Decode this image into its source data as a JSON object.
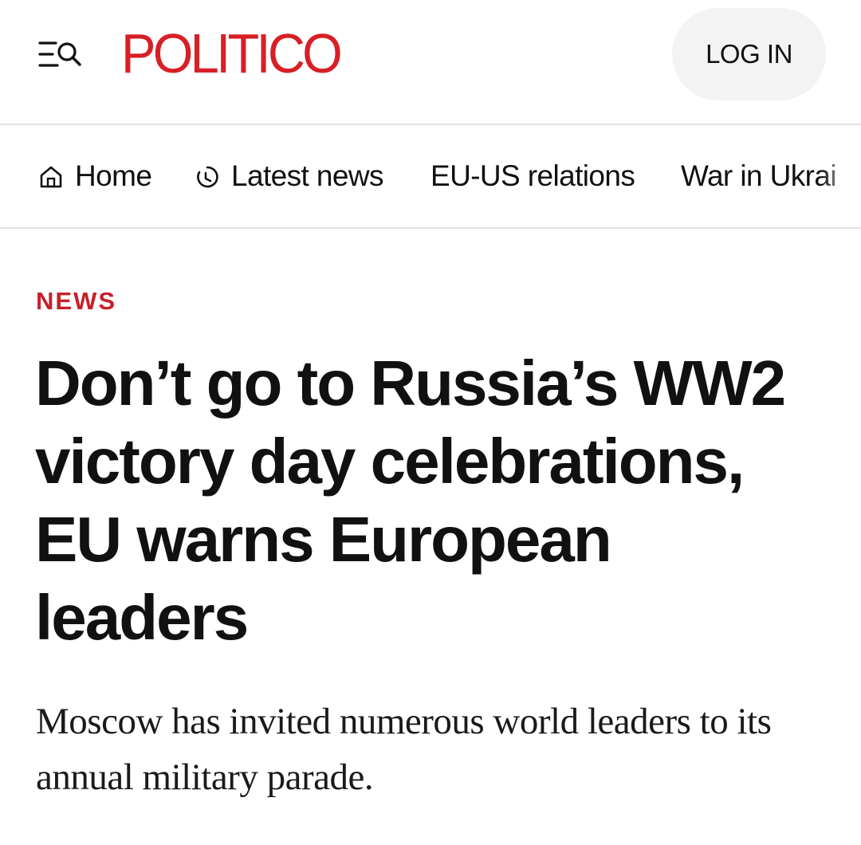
{
  "header": {
    "menu_icon": "menu-search-icon",
    "logo_text": "POLITICO",
    "brand_color": "#d81f26",
    "login_label": "LOG IN"
  },
  "nav": {
    "items": [
      {
        "label": "Home",
        "icon": "home-icon"
      },
      {
        "label": "Latest news",
        "icon": "clock-icon"
      },
      {
        "label": "EU-US relations"
      },
      {
        "label": "War in Ukrai"
      }
    ]
  },
  "article": {
    "kicker": "NEWS",
    "kicker_color": "#c8202a",
    "headline": "Don’t go to Russia’s WW2 victory day celebrations, EU warns European leaders",
    "dek": "Moscow has invited numerous world leaders to its annual military parade."
  }
}
